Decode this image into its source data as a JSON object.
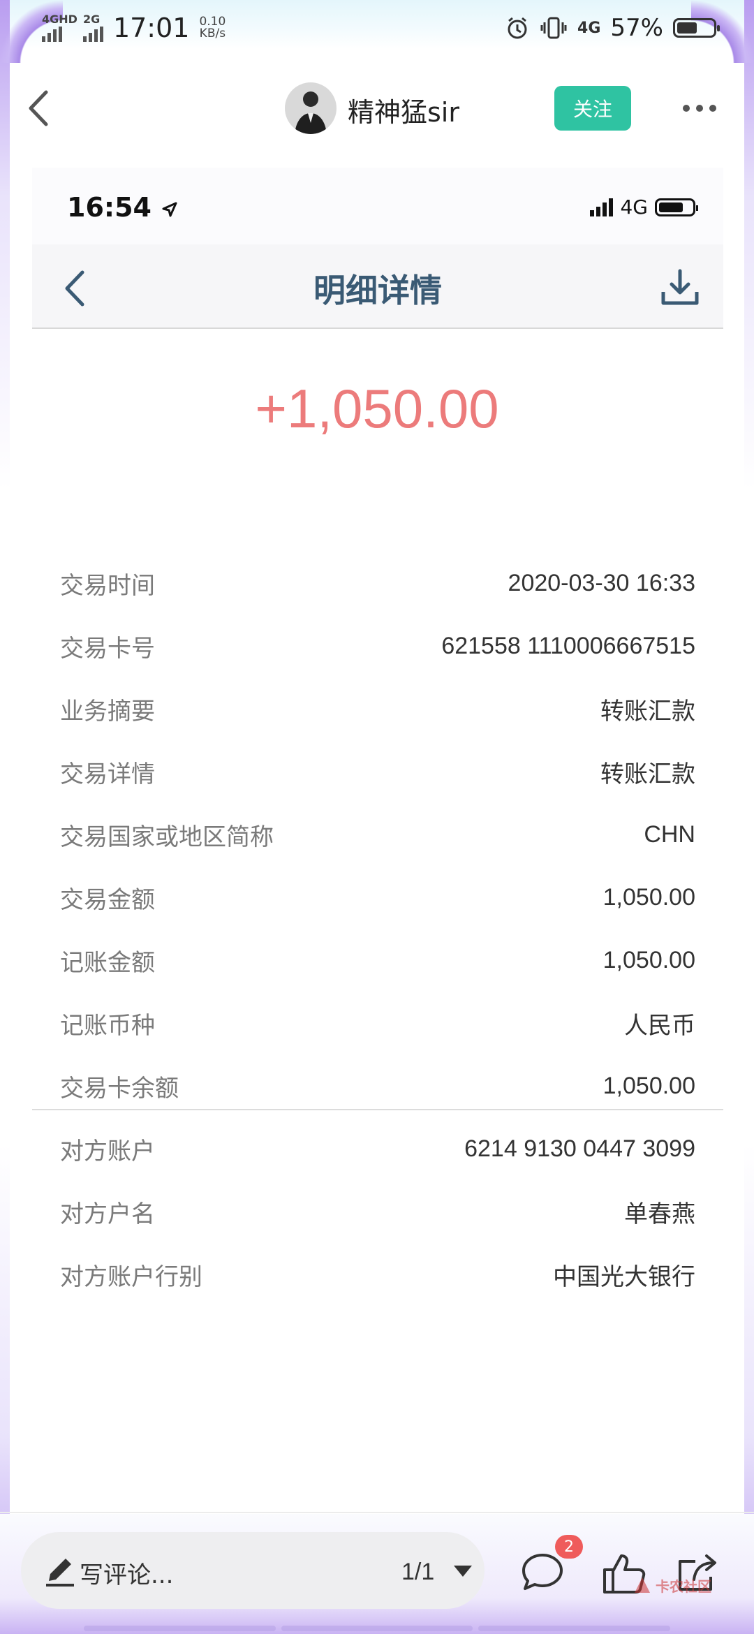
{
  "status_bar": {
    "net1": "4GHD",
    "net2": "2G",
    "time": "17:01",
    "speed_value": "0.10",
    "speed_unit": "KB/s",
    "net_right": "4G",
    "battery_percent": "57%",
    "battery_level": 0.57
  },
  "post_header": {
    "author": "精神猛sir",
    "follow_label": "关注"
  },
  "embedded_screen": {
    "status_time": "16:54",
    "status_network": "4G",
    "title": "明细详情",
    "amount": "+1,050.00",
    "details": [
      {
        "key": "交易时间",
        "value": "2020-03-30 16:33"
      },
      {
        "key": "交易卡号",
        "value": "621558 1110006667515"
      },
      {
        "key": "业务摘要",
        "value": "转账汇款"
      },
      {
        "key": "交易详情",
        "value": "转账汇款"
      },
      {
        "key": "交易国家或地区简称",
        "value": "CHN"
      },
      {
        "key": "交易金额",
        "value": "1,050.00"
      },
      {
        "key": "记账金额",
        "value": "1,050.00"
      },
      {
        "key": "记账币种",
        "value": "人民币"
      },
      {
        "key": "交易卡余额",
        "value": "1,050.00"
      },
      {
        "key": "对方账户",
        "value": "6214 9130 0447 3099"
      },
      {
        "key": "对方户名",
        "value": "单春燕"
      },
      {
        "key": "对方账户行别",
        "value": "中国光大银行"
      }
    ]
  },
  "bottom_bar": {
    "comment_placeholder": "写评论...",
    "page_indicator": "1/1",
    "comment_count": "2",
    "watermark": "卡农社区"
  },
  "colors": {
    "follow": "#2fc3a2",
    "amount": "#ec7b7b",
    "title": "#3a5a74",
    "badge": "#ef5b5b"
  },
  "icons": [
    "back-icon",
    "more-icon",
    "location-arrow-icon",
    "download-icon",
    "pen-icon",
    "chat-bubble-icon",
    "thumbs-up-icon",
    "share-icon",
    "alarm-icon",
    "vibrate-icon"
  ]
}
